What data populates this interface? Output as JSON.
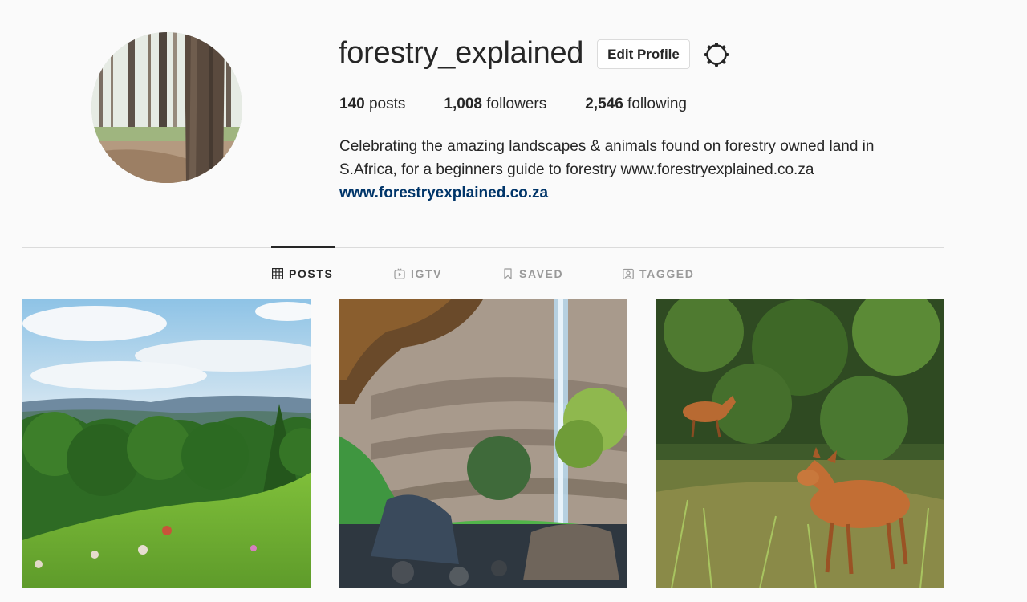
{
  "profile": {
    "username": "forestry_explained",
    "edit_button": "Edit Profile",
    "settings_icon": "gear-icon",
    "stats": {
      "posts_count": "140",
      "posts_label": "posts",
      "followers_count": "1,008",
      "followers_label": "followers",
      "following_count": "2,546",
      "following_label": "following"
    },
    "bio_line1": "Celebrating the amazing landscapes & animals found on forestry owned land in",
    "bio_line2": "S.Africa, for a beginners guide to forestry www.forestryexplained.co.za",
    "website": "www.forestryexplained.co.za",
    "link_color": "#003569"
  },
  "tabs": [
    {
      "label": "POSTS",
      "icon": "grid-icon",
      "active": true
    },
    {
      "label": "IGTV",
      "icon": "tv-icon",
      "active": false
    },
    {
      "label": "SAVED",
      "icon": "bookmark-icon",
      "active": false
    },
    {
      "label": "TAGGED",
      "icon": "tag-portrait-icon",
      "active": false
    }
  ]
}
